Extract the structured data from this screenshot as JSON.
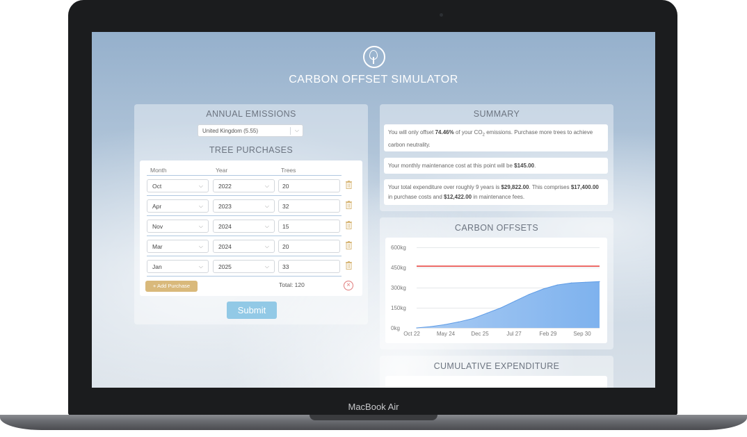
{
  "device": {
    "label": "MacBook Air"
  },
  "app": {
    "title": "CARBON OFFSET SIMULATOR",
    "logo_icon": "tree-icon"
  },
  "emissions": {
    "title": "ANNUAL EMISSIONS",
    "country": "United Kingdom (5.55)"
  },
  "purchases": {
    "title": "TREE PURCHASES",
    "columns": [
      "Month",
      "Year",
      "Trees"
    ],
    "rows": [
      {
        "month": "Oct",
        "year": "2022",
        "trees": "20"
      },
      {
        "month": "Apr",
        "year": "2023",
        "trees": "32"
      },
      {
        "month": "Nov",
        "year": "2024",
        "trees": "15"
      },
      {
        "month": "Mar",
        "year": "2024",
        "trees": "20"
      },
      {
        "month": "Jan",
        "year": "2025",
        "trees": "33"
      }
    ],
    "add_label": "+ Add Purchase",
    "total_label": "Total: 120",
    "submit_label": "Submit"
  },
  "summary": {
    "title": "SUMMARY",
    "p1_a": "You will only offset ",
    "p1_pct": "74.46%",
    "p1_b": " of your CO",
    "p1_sub": "2",
    "p1_c": " emissions. Purchase more trees to achieve carbon neutrality.",
    "p2_a": "Your monthly maintenance cost at this point will be ",
    "p2_amt": "$145.00",
    "p2_b": ".",
    "p3_a": "Your total expenditure over roughly 9 years is ",
    "p3_total": "$29,822.00",
    "p3_b": ". This comprises ",
    "p3_purchase": "$17,400.00",
    "p3_c": " in purchase costs and ",
    "p3_maint": "$12,422.00",
    "p3_d": " in maintenance fees."
  },
  "offsets": {
    "title": "CARBON OFFSETS"
  },
  "expenditure": {
    "title": "CUMULATIVE EXPENDITURE"
  },
  "chart_data": {
    "type": "area",
    "title": "CARBON OFFSETS",
    "y_ticks": [
      "600kg",
      "450kg",
      "300kg",
      "150kg",
      "0kg"
    ],
    "x_ticks": [
      "Oct 22",
      "May 24",
      "Dec 25",
      "Jul 27",
      "Feb 29",
      "Sep 30"
    ],
    "ylim": [
      0,
      600
    ],
    "target_line": 460,
    "series": [
      {
        "x": [
          "Oct 22",
          "Jun 23",
          "Feb 24",
          "Oct 24",
          "Jun 25",
          "Feb 26",
          "Oct 26",
          "Jun 27",
          "Feb 28",
          "Oct 28",
          "Jun 29",
          "Feb 30",
          "Oct 30",
          "Apr 31"
        ],
        "values": [
          0,
          10,
          25,
          45,
          70,
          110,
          150,
          200,
          250,
          290,
          320,
          335,
          340,
          345
        ]
      }
    ],
    "colors": {
      "area": "#a9cbf3",
      "area_dark": "#7eb2ee",
      "target": "#e53935"
    }
  }
}
